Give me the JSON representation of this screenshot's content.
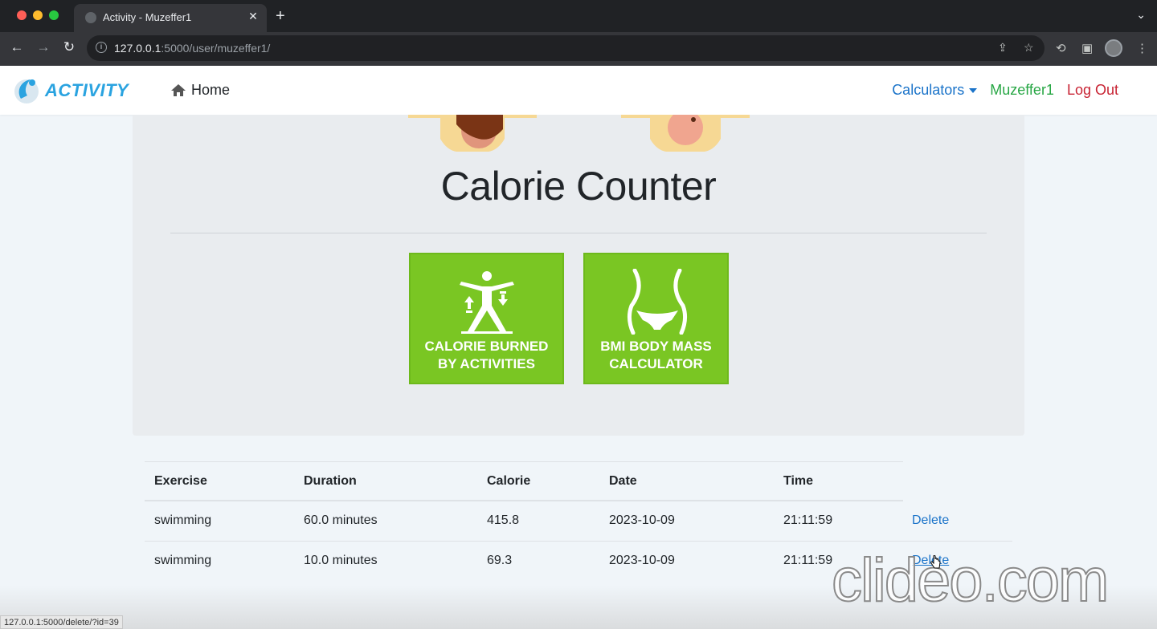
{
  "browser": {
    "tab_title": "Activity - Muzeffer1",
    "tab_close": "✕",
    "new_tab": "+",
    "url_host": "127.0.0.1",
    "url_rest": ":5000/user/muzeffer1/"
  },
  "navbar": {
    "brand": "ACTIVITY",
    "home": "Home",
    "calculators": "Calculators",
    "username": "Muzeffer1",
    "logout": "Log Out"
  },
  "hero": {
    "title": "Calorie Counter",
    "cards": [
      {
        "line1": "CALORIE BURNED",
        "line2": "BY ACTIVITIES"
      },
      {
        "line1": "BMI BODY MASS",
        "line2": "CALCULATOR"
      }
    ]
  },
  "table": {
    "headers": [
      "Exercise",
      "Duration",
      "Calorie",
      "Date",
      "Time"
    ],
    "rows": [
      {
        "exercise": "swimming",
        "duration": "60.0 minutes",
        "calorie": "415.8",
        "date": "2023-10-09",
        "time": "21:11:59",
        "action": "Delete"
      },
      {
        "exercise": "swimming",
        "duration": "10.0 minutes",
        "calorie": "69.3",
        "date": "2023-10-09",
        "time": "21:11:59",
        "action": "Delete"
      }
    ]
  },
  "status_bar": "127.0.0.1:5000/delete/?id=39",
  "watermark": "clideo.com",
  "colors": {
    "brand": "#2aa3e0",
    "link": "#1a73c9",
    "user": "#28a745",
    "logout": "#c82333",
    "card": "#7ac623"
  }
}
